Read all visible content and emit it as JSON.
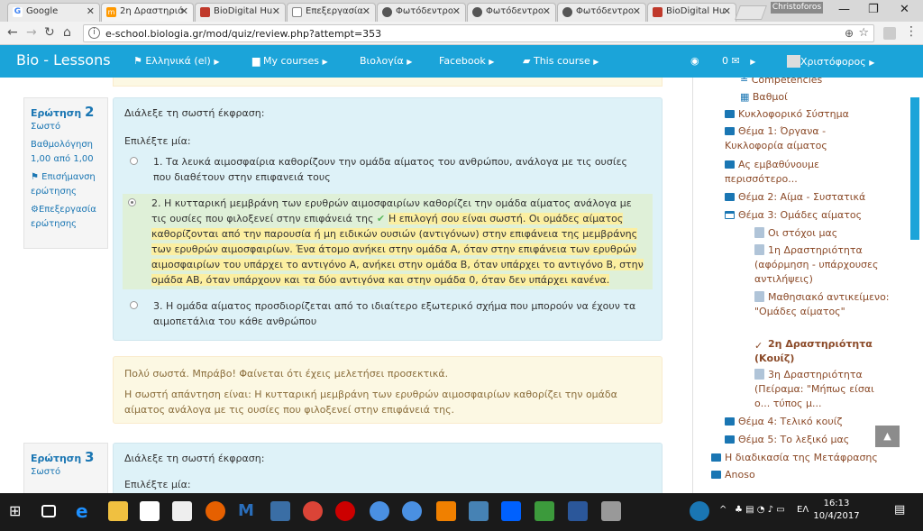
{
  "browser": {
    "tabs": [
      {
        "title": "Google",
        "active": false
      },
      {
        "title": "2η Δραστηριό",
        "active": true
      },
      {
        "title": "BioDigital Hu",
        "active": false
      },
      {
        "title": "Επεξεργασία",
        "active": false
      },
      {
        "title": "Φωτόδεντρο",
        "active": false
      },
      {
        "title": "Φωτόδεντρο",
        "active": false
      },
      {
        "title": "Φωτόδεντρο",
        "active": false
      },
      {
        "title": "BioDigital Hu",
        "active": false
      }
    ],
    "profile_name": "Christoforos",
    "url": "e-school.biologia.gr/mod/quiz/review.php?attempt=353"
  },
  "navbar": {
    "brand": "Bio - Lessons",
    "language": "Ελληνικά (el)",
    "my_courses": "My courses",
    "biology": "Βιολογία",
    "facebook": "Facebook",
    "this_course": "This course",
    "messages": "0",
    "user": "Χριστόφορος"
  },
  "question2": {
    "label": "Ερώτηση",
    "number": "2",
    "status": "Σωστό",
    "grade_label": "Βαθμολόγηση",
    "grade_value": "1,00 από 1,00",
    "flag": "Επισήμανση ερώτησης",
    "edit": "Επεξεργασία ερώτησης",
    "prompt": "Διάλεξε τη σωστή έκφραση:",
    "choose": "Επιλέξτε μία:",
    "options": [
      "1. Τα λευκά αιμοσφαίρια καθορίζουν την ομάδα αίματος του ανθρώπου, ανάλογα με τις ουσίες που διαθέτουν στην επιφανειά τους",
      "2. Η κυτταρική μεμβράνη των ερυθρών αιμοσφαιρίων καθορίζει την ομάδα αίματος ανάλογα με τις ουσίες που φιλοξενεί στην επιφάνειά της",
      "3. Η ομάδα αίματος προσδιορίζεται από το ιδιαίτερο εξωτερικό σχήμα που μπορούν να έχουν τα αιμοπετάλια του κάθε ανθρώπου"
    ],
    "option_feedback": "Η επιλογή σου είναι σωστή. Οι ομάδες αίματος καθορίζονται από την παρουσία ή μη ειδικών ουσιών (αντιγόνων) στην επιφάνεια της μεμβράνης των ερυθρών αιμοσφαιρίων. Ένα άτομο ανήκει στην ομάδα Α, όταν στην επιφάνεια των ερυθρών αιμοσφαιρίων του υπάρχει το αντιγόνο Α, ανήκει στην ομάδα Β, όταν υπάρχει το αντιγόνο Β, στην ομάδα ΑΒ, όταν υπάρχουν και τα δύο αντιγόνα και στην ομάδα 0, όταν δεν υπάρχει κανένα.",
    "general_feedback": "Πολύ σωστά. Μπράβο! Φαίνεται ότι έχεις μελετήσει προσεκτικά.",
    "right_answer": "Η σωστή απάντηση είναι: Η κυτταρική μεμβράνη των ερυθρών αιμοσφαιρίων καθορίζει την ομάδα αίματος ανάλογα με τις ουσίες που φιλοξενεί στην επιφάνειά της."
  },
  "question3": {
    "label": "Ερώτηση",
    "number": "3",
    "status": "Σωστό",
    "prompt": "Διάλεξε τη σωστή έκφραση:",
    "choose": "Επιλέξτε μία:"
  },
  "sidebar": {
    "competencies": "Competencies",
    "grades": "Βαθμοί",
    "items": [
      "Κυκλοφορικό Σύστημα",
      "Θέμα 1: Όργανα - Κυκλοφορία αίματος",
      "Ας εμβαθύνουμε περισσότερο...",
      "Θέμα 2: Αίμα - Συστατικά",
      "Θέμα 3: Ομάδες αίματος",
      "Οι στόχοι μας",
      "1η Δραστηριότητα (αφόρμηση - υπάρχουσες αντιλήψεις)",
      "Μαθησιακό αντικείμενο: \"Ομάδες αίματος\"",
      "2η Δραστηριότητα (Κουίζ)",
      "3η Δραστηριότητα (Πείραμα: \"Μήπως είσαι ο... τύπος μ...",
      "Θέμα 4: Τελικό κουίζ",
      "Θέμα 5: Το λεξικό μας",
      "Η διαδικασία της Μετάφρασης",
      "Anoso"
    ]
  },
  "taskbar": {
    "time": "16:13",
    "date": "10/4/2017",
    "lang": "ΕΛ"
  }
}
